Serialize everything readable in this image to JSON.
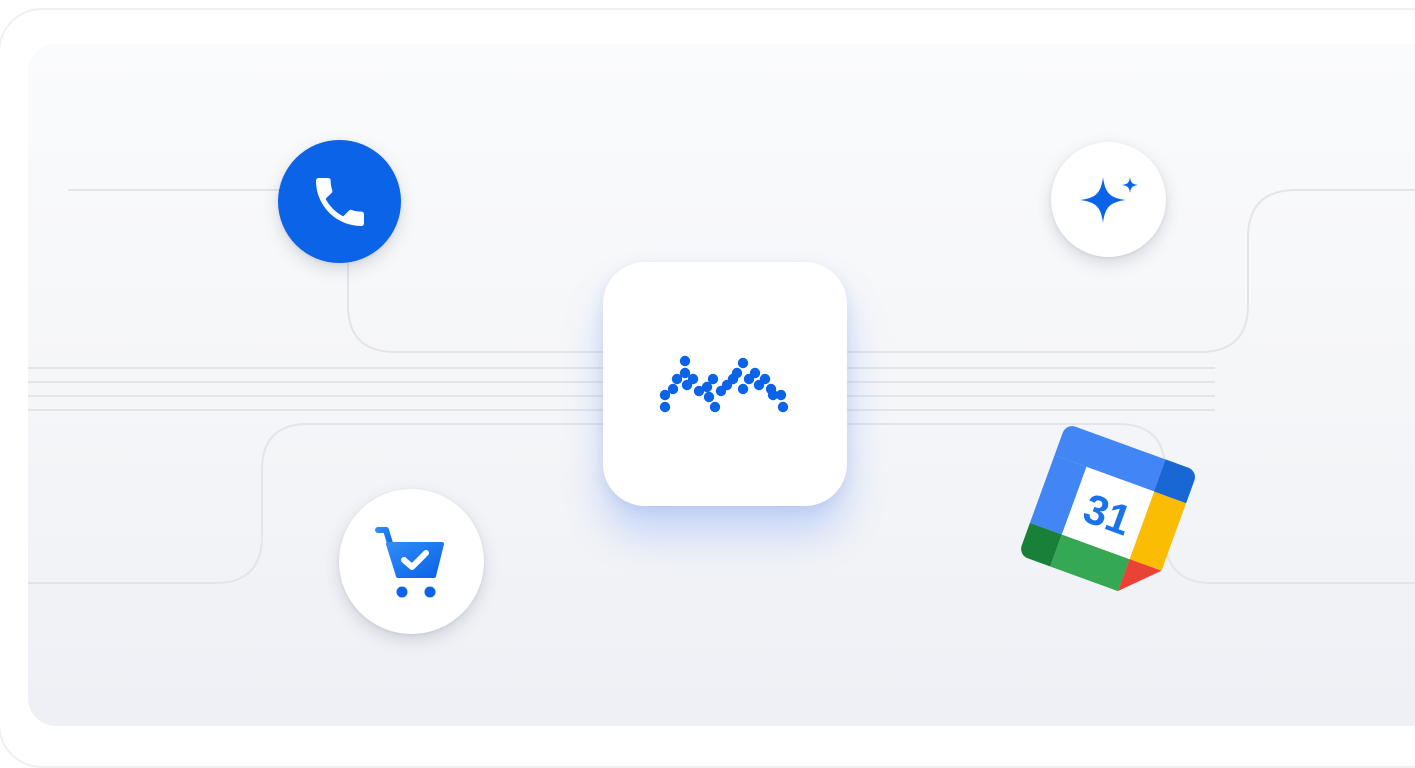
{
  "integrations": {
    "phone": {
      "icon": "phone-icon",
      "color": "#0b63e8"
    },
    "assistant": {
      "icon": "sparkle-icon",
      "color": "#0b63e8"
    },
    "shopping": {
      "icon": "shopping-cart-check-icon",
      "color": "#1a73e8"
    },
    "calendar": {
      "icon": "calendar-icon",
      "day": "31"
    }
  },
  "hub": {
    "icon": "matrix-logo-icon",
    "color": "#0b63e8"
  },
  "colors": {
    "accent": "#0b63e8",
    "background": "#f5f6f8",
    "line": "#e3e5ea"
  }
}
